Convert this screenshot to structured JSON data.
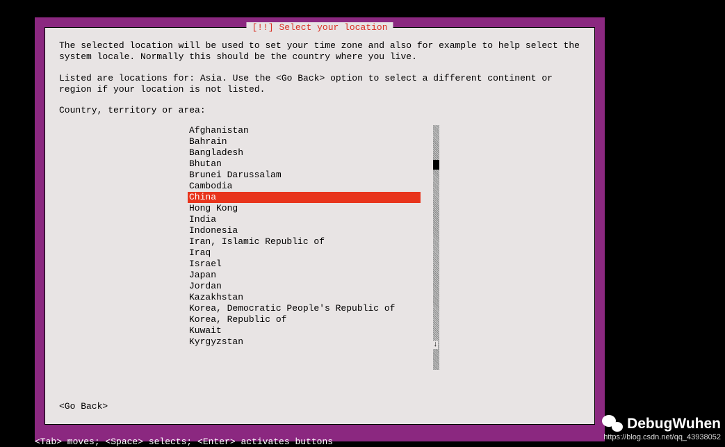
{
  "dialog": {
    "title": "[!!] Select your location",
    "description_line1": "The selected location will be used to set your time zone and also for example to help select the system locale. Normally this should be the country where you live.",
    "description_line2": "Listed are locations for: Asia. Use the <Go Back> option to select a different continent or region if your location is not listed.",
    "list_label": "Country, territory or area:",
    "items": [
      "Afghanistan",
      "Bahrain",
      "Bangladesh",
      "Bhutan",
      "Brunei Darussalam",
      "Cambodia",
      "China",
      "Hong Kong",
      "India",
      "Indonesia",
      "Iran, Islamic Republic of",
      "Iraq",
      "Israel",
      "Japan",
      "Jordan",
      "Kazakhstan",
      "Korea, Democratic People's Republic of",
      "Korea, Republic of",
      "Kuwait",
      "Kyrgyzstan"
    ],
    "selected_index": 6,
    "go_back": "<Go Back>"
  },
  "footer_hint": "<Tab> moves; <Space> selects; <Enter> activates buttons",
  "watermark": {
    "name": "DebugWuhen",
    "url": "https://blog.csdn.net/qq_43938052"
  }
}
